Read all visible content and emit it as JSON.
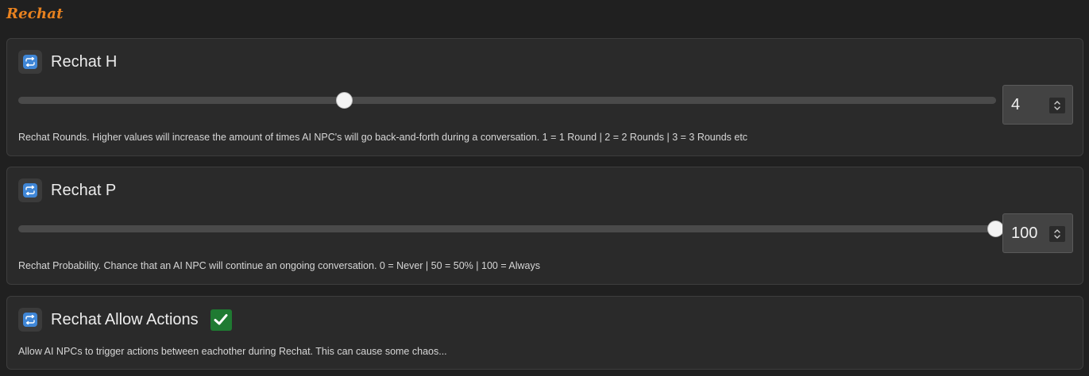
{
  "section": {
    "title": "Rechat"
  },
  "settings": [
    {
      "icon": "repeat-icon",
      "title": "Rechat H",
      "value": "4",
      "slider": {
        "min": 0,
        "max": 12,
        "value": 4
      },
      "description": "Rechat Rounds. Higher values will increase the amount of times AI NPC's will go back-and-forth during a conversation. 1 = 1 Round | 2 = 2 Rounds | 3 = 3 Rounds etc"
    },
    {
      "icon": "repeat-icon",
      "title": "Rechat P",
      "value": "100",
      "slider": {
        "min": 0,
        "max": 100,
        "value": 100
      },
      "description": "Rechat Probability. Chance that an AI NPC will continue an ongoing conversation. 0 = Never | 50 = 50% | 100 = Always"
    },
    {
      "icon": "repeat-icon",
      "title": "Rechat Allow Actions",
      "checked": true,
      "description": "Allow AI NPCs to trigger actions between eachother during Rechat. This can cause some chaos..."
    }
  ],
  "colors": {
    "accent": "#e8821f",
    "icon_blue": "#3f86d6",
    "checkbox_green": "#1f7a32"
  }
}
